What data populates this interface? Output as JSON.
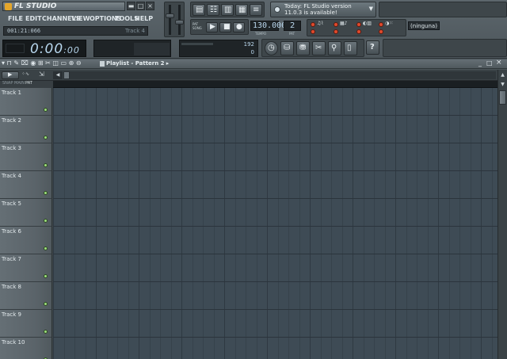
{
  "app": {
    "title": "FL STUDIO"
  },
  "menu": [
    "FILE",
    "EDIT",
    "CHANNELS",
    "VIEW",
    "OPTIONS",
    "TOOLS",
    "HELP"
  ],
  "status": {
    "time_small": "001:21:066",
    "track_hint": "Track 4"
  },
  "song_time": {
    "main": "0:00",
    "ms": ":00"
  },
  "transport": {
    "tempo": "130.000",
    "pattern": "2",
    "tempo_label": "TEMPO",
    "pattern_label": "PAT"
  },
  "cpu": {
    "value": "192",
    "poly": "0"
  },
  "news": {
    "line1": "Today: FL Studio version",
    "line2": "11.0.3 is available!"
  },
  "midi_device": "(ninguna)",
  "playlist": {
    "title": "Playlist - Pattern 2",
    "header_tabs": [
      "SNAP",
      "MAIN",
      "PAT"
    ]
  },
  "tracks": [
    {
      "label": "Track 1"
    },
    {
      "label": "Track 2"
    },
    {
      "label": "Track 3"
    },
    {
      "label": "Track 4"
    },
    {
      "label": "Track 5"
    },
    {
      "label": "Track 6"
    },
    {
      "label": "Track 7"
    },
    {
      "label": "Track 8"
    },
    {
      "label": "Track 9"
    },
    {
      "label": "Track 10"
    }
  ],
  "colors": {
    "grid_bg": "#3e4b55",
    "track_led": "#9de07c",
    "accent": "#e4a62b",
    "display_text": "#b8d7ee"
  },
  "icons": [
    "fl-logo-icon",
    "minimize-icon",
    "restore-icon",
    "close-icon",
    "play-icon",
    "stop-icon",
    "record-icon",
    "mixer-icon",
    "piano-roll-icon",
    "playlist-icon",
    "browser-icon",
    "metronome-icon",
    "info-icon"
  ]
}
